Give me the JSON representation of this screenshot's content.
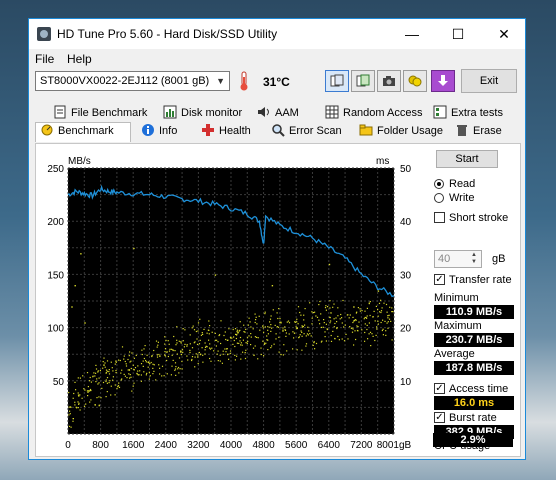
{
  "window": {
    "title": "HD Tune Pro 5.60 - Hard Disk/SSD Utility"
  },
  "menu": {
    "file": "File",
    "help": "Help"
  },
  "toolbar": {
    "drive": "ST8000VX0022-2EJ112 (8001 gB)",
    "temperature": "31°C",
    "exit_label": "Exit",
    "icons": [
      "copy-icon",
      "copy-info-icon",
      "camera-icon",
      "health-coins-icon",
      "download-icon"
    ]
  },
  "tabs_top": [
    "File Benchmark",
    "Disk monitor",
    "AAM",
    "Random Access",
    "Extra tests"
  ],
  "tabs_bottom": [
    "Benchmark",
    "Info",
    "Health",
    "Error Scan",
    "Folder Usage",
    "Erase"
  ],
  "chart_data": {
    "type": "scatter",
    "left_axis_unit": "MB/s",
    "right_axis_unit": "ms",
    "yticks_left": [
      "250",
      "200",
      "150",
      "100",
      "50"
    ],
    "yticks_right": [
      "50",
      "40",
      "30",
      "20",
      "10"
    ],
    "xticks": [
      "0",
      "800",
      "1600",
      "2400",
      "3200",
      "4000",
      "4800",
      "5600",
      "6400",
      "7200",
      "8001gB"
    ],
    "xlim": [
      0,
      8001
    ],
    "ylim_left": [
      0,
      250
    ],
    "ylim_right": [
      0,
      50
    ],
    "grid": true,
    "series": [
      {
        "name": "Transfer rate",
        "color": "#1e90d8",
        "type": "line",
        "axis": "left",
        "x": [
          0,
          200,
          400,
          600,
          800,
          1000,
          1200,
          1600,
          2000,
          2400,
          2800,
          3200,
          3600,
          4000,
          4400,
          4700,
          4800,
          4850,
          5200,
          5600,
          6000,
          6400,
          6800,
          7200,
          7600,
          8001
        ],
        "y": [
          225,
          228,
          226,
          224,
          230,
          228,
          227,
          226,
          225,
          223,
          221,
          219,
          216,
          212,
          207,
          200,
          178,
          205,
          196,
          190,
          184,
          175,
          165,
          150,
          138,
          130
        ]
      },
      {
        "name": "Access time",
        "color": "#d9d92a",
        "type": "scatter",
        "axis": "right",
        "trend": {
          "x": [
            0,
            800,
            1600,
            2400,
            3200,
            4000,
            4800,
            5600,
            6400,
            7200,
            8001
          ],
          "y": [
            5,
            10,
            13,
            15,
            17,
            18,
            19,
            20,
            21,
            21,
            22
          ]
        },
        "spread": 5,
        "outliers": [
          {
            "x": 80,
            "y": 24
          },
          {
            "x": 160,
            "y": 28
          },
          {
            "x": 300,
            "y": 34
          },
          {
            "x": 400,
            "y": 21
          },
          {
            "x": 1600,
            "y": 35
          },
          {
            "x": 3600,
            "y": 30
          },
          {
            "x": 5000,
            "y": 28
          },
          {
            "x": 5600,
            "y": 20
          },
          {
            "x": 6400,
            "y": 32
          },
          {
            "x": 7000,
            "y": 24
          },
          {
            "x": 7600,
            "y": 27
          }
        ]
      }
    ]
  },
  "panel": {
    "start_label": "Start",
    "read_label": "Read",
    "write_label": "Write",
    "short_stroke_label": "Short stroke",
    "stroke_value": "40",
    "stroke_unit": "gB",
    "transfer_rate_label": "Transfer rate",
    "minimum_label": "Minimum",
    "minimum_value": "110.9 MB/s",
    "maximum_label": "Maximum",
    "maximum_value": "230.7 MB/s",
    "average_label": "Average",
    "average_value": "187.8 MB/s",
    "access_time_label": "Access time",
    "access_time_value": "16.0 ms",
    "burst_rate_label": "Burst rate",
    "burst_rate_value": "382.9 MB/s",
    "cpu_usage_label": "CPU usage",
    "cpu_usage_value": "2.9%"
  }
}
